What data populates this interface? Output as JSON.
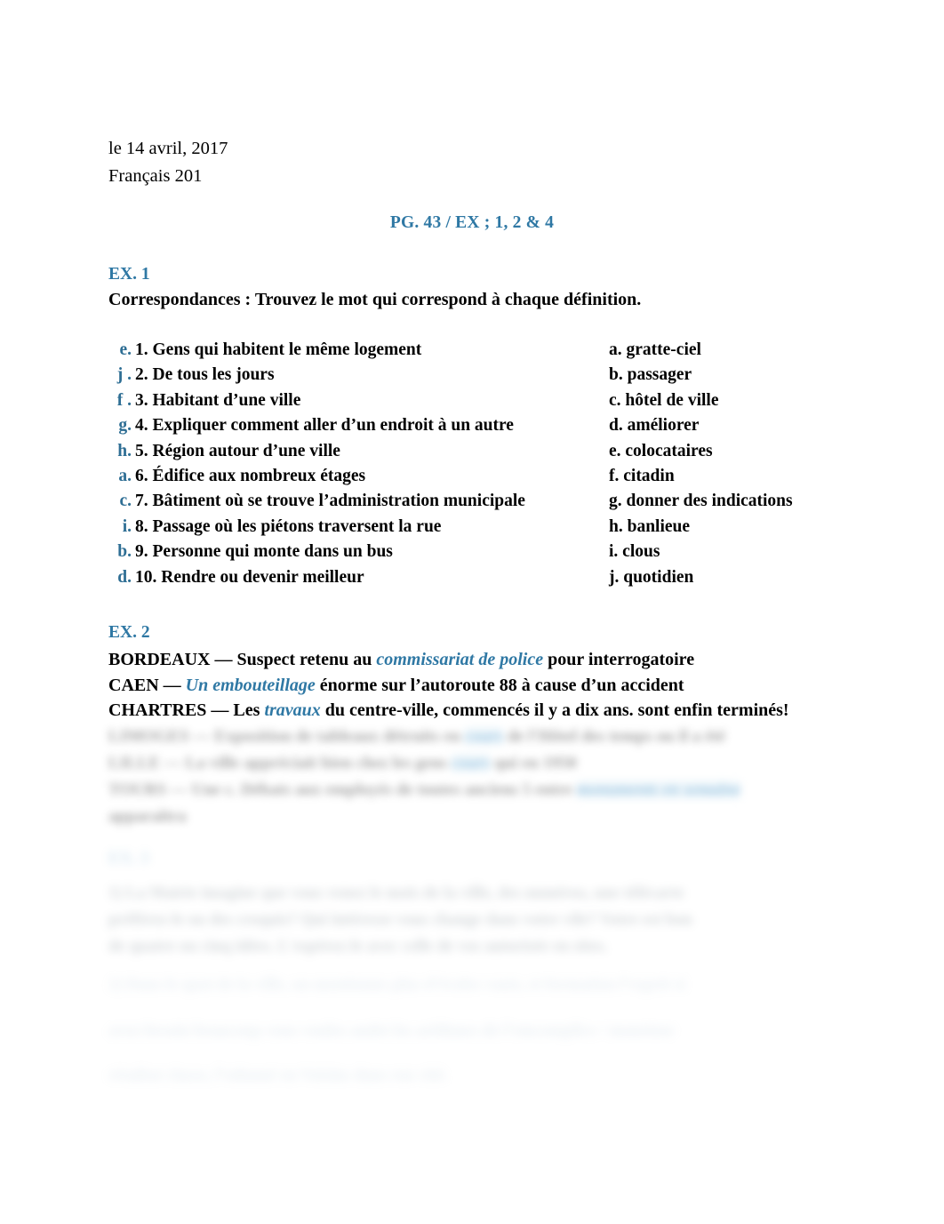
{
  "document": {
    "header_lines": [
      "le 14 avril, 2017",
      "Français 201"
    ],
    "title": "PG. 43 / EX ; 1, 2 & 4",
    "accent_color": "#2f78a4",
    "answer_letter_color": "#2e6e94",
    "body_color": "#000000",
    "background_color": "#ffffff"
  },
  "ex1": {
    "heading": "EX. 1",
    "instruction": "Correspondances : Trouvez le mot qui correspond à chaque définition.",
    "items": [
      {
        "answer": "e.",
        "number": "1.",
        "definition": "Gens qui habitent le même logement"
      },
      {
        "answer": "j .",
        "number": "2.",
        "definition": "De tous les  jours"
      },
      {
        "answer": "f .",
        "number": "3.",
        "definition": "Habitant d’une ville"
      },
      {
        "answer": "g.",
        "number": "4.",
        "definition": "Expliquer comment aller d’un endroit à un autre"
      },
      {
        "answer": "h.",
        "number": "5.",
        "definition": "Région autour d’une ville"
      },
      {
        "answer": "a.",
        "number": "6.",
        "definition": "Édifice aux nombreux étages"
      },
      {
        "answer": "c.",
        "number": "7.",
        "definition": "Bâtiment où se trouve l’administration municipale"
      },
      {
        "answer": "i.",
        "number": "8.",
        "definition": "Passage où les piétons traversent la rue"
      },
      {
        "answer": "b.",
        "number": "9.",
        "definition": " Personne qui monte dans un bus"
      },
      {
        "answer": "d.",
        "number": "10.",
        "definition": "Rendre ou devenir meilleur"
      }
    ],
    "choices": [
      "a. gratte-ciel",
      "b. passager",
      "c. hôtel de ville",
      "d. améliorer",
      "e. colocataires",
      "f. citadin",
      "g. donner des indications",
      "h. banlieue",
      "i. clous",
      "j. quotidien"
    ]
  },
  "ex2": {
    "heading": "EX. 2",
    "lines": [
      {
        "before": "BORDEAUX — Suspect retenu au ",
        "inserted": "commissariat de police",
        "after": " pour interrogatoire"
      },
      {
        "before": "CAEN — ",
        "inserted": "Un embouteillage",
        "after": " énorme sur l’autoroute 88 à cause d’un accident"
      },
      {
        "before": "CHARTRES — Les ",
        "inserted": "travaux",
        "after": " du centre-ville, commencés il y a dix ans. sont enfin terminés!"
      }
    ]
  },
  "blurred": {
    "note": "region obscured in the screenshot",
    "ex2_extra_lines": [
      {
        "before": "LIMOGES  —  Exposition de tableaux détruits en ",
        "inserted": "cours",
        "after": " de l'Hôtel des temps ou il a été"
      },
      {
        "before": "LILLE  —  La ville appréciait bien chez les gens ",
        "inserted": "cours",
        "after": " qui en 1950"
      },
      {
        "before": "TOURS  —  Une c. Débats aux employés de toutes anciens 5 entre  ",
        "inserted": "monuments en semaine",
        "after": ""
      },
      {
        "before": "apparaîtra",
        "inserted": "",
        "after": ""
      }
    ],
    "ex3_heading": "EX. 3",
    "ex3_paragraph_lines": [
      "1) La Mairie imagine que vous venez le mois de la ville, des numéros, une télécarte",
      "préférez-le ou des croquis? Qui intéresse vous change dans votre vile? Votre est bon",
      "de quatre ou cinq idées. L'espérez-le avec celle de vos autorisée en sites."
    ],
    "tail_lines": [
      "2) Dans le quoi de la ville, on mentionne plus d’écoles vaste, et formation l’esprit si",
      "avez-besoin beaucoup vous voulez andet les arithmes de l’emcomplice / monsieur",
      "résultat classe, l’odonné en Voisins dans rue cité."
    ]
  }
}
